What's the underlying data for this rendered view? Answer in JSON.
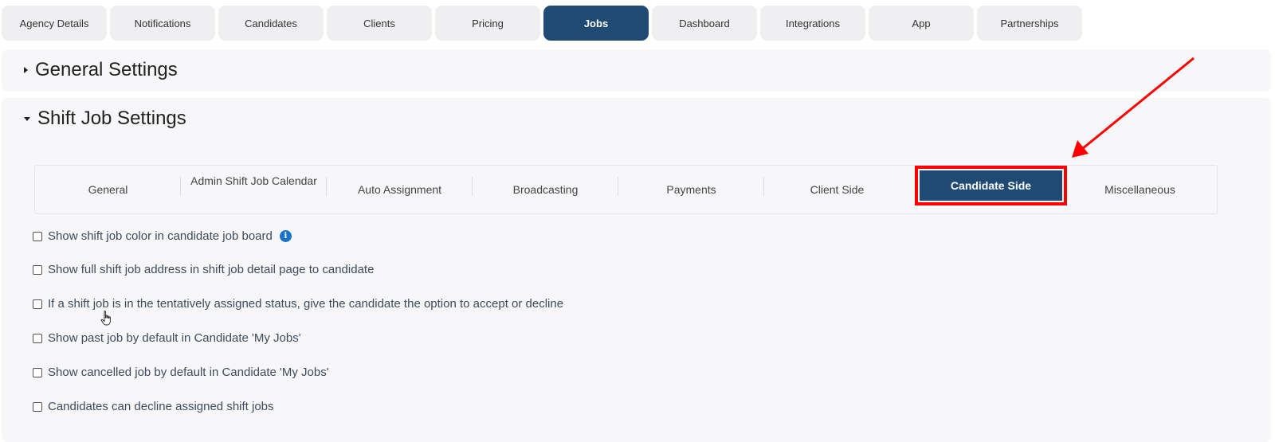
{
  "top_tabs": [
    {
      "label": "Agency Details"
    },
    {
      "label": "Notifications"
    },
    {
      "label": "Candidates"
    },
    {
      "label": "Clients"
    },
    {
      "label": "Pricing"
    },
    {
      "label": "Jobs",
      "active": true
    },
    {
      "label": "Dashboard"
    },
    {
      "label": "Integrations"
    },
    {
      "label": "App"
    },
    {
      "label": "Partnerships"
    }
  ],
  "sections": {
    "general": {
      "title": "General Settings",
      "expanded": false
    },
    "shift": {
      "title": "Shift Job Settings",
      "expanded": true
    }
  },
  "subtabs": [
    {
      "label": "General"
    },
    {
      "label": "Admin Shift Job Calendar"
    },
    {
      "label": "Auto Assignment"
    },
    {
      "label": "Broadcasting"
    },
    {
      "label": "Payments"
    },
    {
      "label": "Client Side"
    },
    {
      "label": "Candidate Side",
      "active": true
    },
    {
      "label": "Miscellaneous"
    }
  ],
  "options": [
    {
      "label": "Show shift job color in candidate job board",
      "checked": false,
      "info": true
    },
    {
      "label": "Show full shift job address in shift job detail page to candidate",
      "checked": false
    },
    {
      "label": "If a shift job is in the tentatively assigned status, give the candidate the option to accept or decline",
      "checked": false
    },
    {
      "label": "Show past job by default in Candidate 'My Jobs'",
      "checked": false
    },
    {
      "label": "Show cancelled job by default in Candidate 'My Jobs'",
      "checked": false
    },
    {
      "label": "Candidates can decline assigned shift jobs",
      "checked": false
    }
  ],
  "icons": {
    "info": "i"
  },
  "colors": {
    "accent": "#1f4a73",
    "highlight": "#ff0000",
    "info": "#1a73c9"
  }
}
